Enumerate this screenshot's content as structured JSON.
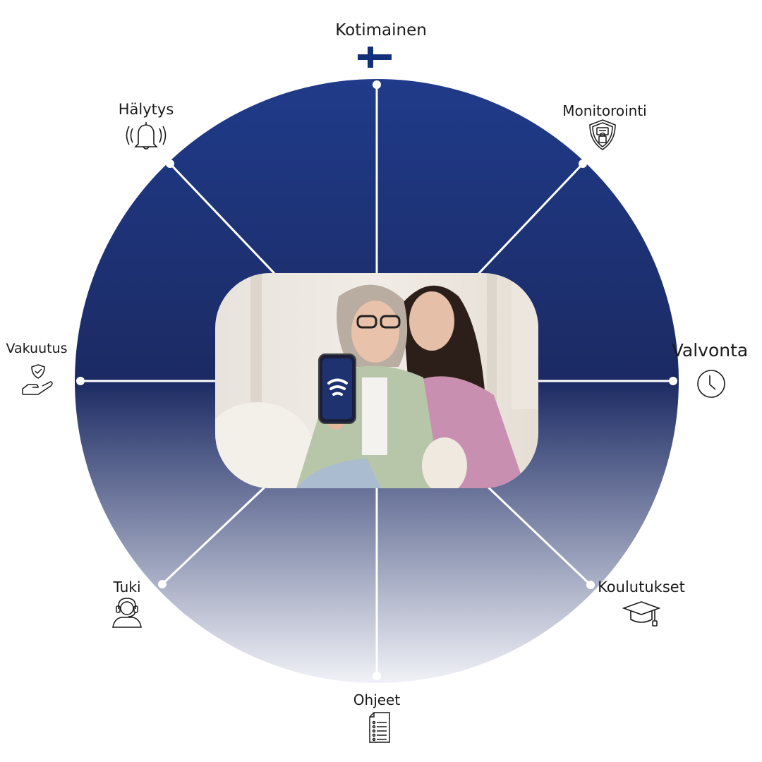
{
  "diagram": {
    "segments": [
      {
        "key": "kotimainen",
        "label": "Kotimainen",
        "icon": "finnish-flag-cross-icon"
      },
      {
        "key": "monitorointi",
        "label": "Monitorointi",
        "icon": "shield-lock-icon"
      },
      {
        "key": "valvonta",
        "label": "Valvonta",
        "icon": "clock-icon"
      },
      {
        "key": "koulutukset",
        "label": "Koulutukset",
        "icon": "graduation-cap-icon"
      },
      {
        "key": "ohjeet",
        "label": "Ohjeet",
        "icon": "document-list-icon"
      },
      {
        "key": "tuki",
        "label": "Tuki",
        "icon": "headset-support-icon"
      },
      {
        "key": "vakuutus",
        "label": "Vakuutus",
        "icon": "hand-shield-icon"
      },
      {
        "key": "halytys",
        "label": "Hälytys",
        "icon": "ringing-bell-icon"
      }
    ],
    "center_photo": "two-women-holding-phone-with-app-logo",
    "colors": {
      "wheel_top": "#1f3a8a",
      "wheel_mid": "#1b2a63",
      "wheel_bottom": "#f3f4f8",
      "divider": "#ffffff",
      "flag_blue": "#12307a"
    }
  }
}
